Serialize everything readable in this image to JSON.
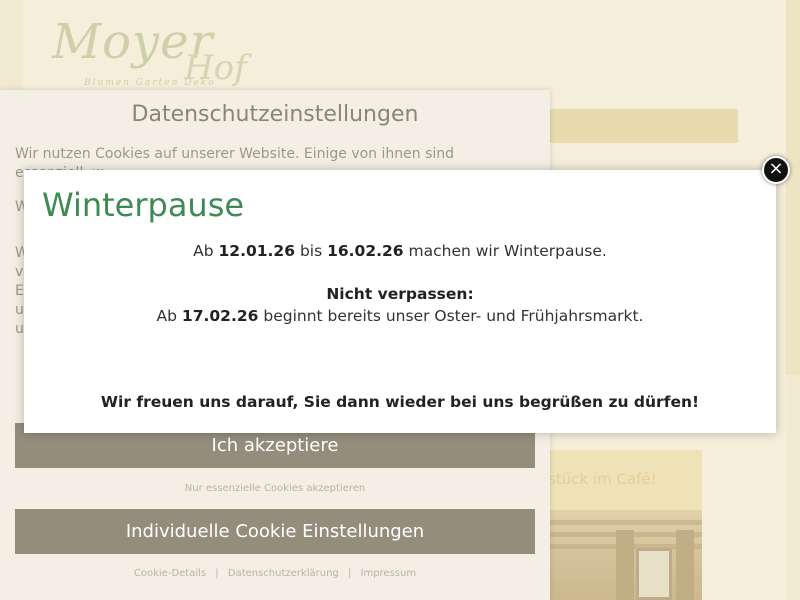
{
  "logo": {
    "main": "Moyer",
    "sub": "Hof",
    "tagline": "Blumen Garten Deko"
  },
  "sidebar_box": {
    "text": "stück im Café!"
  },
  "cookie": {
    "title": "Datenschutzeinstellungen",
    "para1": "Wir nutzen Cookies auf unserer Website. Einige von ihnen sind essenziell, w",
    "para2": "W g",
    "para3": "W v E ( u f u",
    "accept_label": "Ich akzeptiere",
    "essential_label": "Nur essenzielle Cookies akzeptieren",
    "individual_label": "Individuelle Cookie Einstellungen",
    "footer": {
      "details": "Cookie-Details",
      "privacy": "Datenschutzerklärung",
      "imprint": "Impressum",
      "separator": "|"
    }
  },
  "popup": {
    "title": "Winterpause",
    "line1_pre": "Ab ",
    "line1_date1": "12.01.26",
    "line1_mid": " bis ",
    "line1_date2": "16.02.26",
    "line1_post": " machen wir Winterpause.",
    "line2": "Nicht verpassen:",
    "line3_pre": "Ab ",
    "line3_date": "17.02.26",
    "line3_post": " beginnt bereits unser Oster- und Frühjahrsmarkt.",
    "line4": "Wir freuen uns darauf, Sie dann wieder bei uns begrüßen zu dürfen!",
    "close_symbol": "×"
  }
}
